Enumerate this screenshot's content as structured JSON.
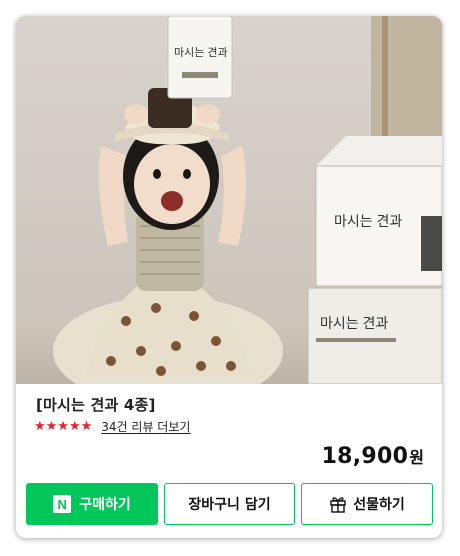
{
  "product": {
    "title": "[마시는 견과 4종]",
    "rating_stars": "★★★★★",
    "review_link": "34건 리뷰 더보기",
    "price": "18,900",
    "currency": "원",
    "package_text": "마시는 견과"
  },
  "buttons": {
    "buy_icon": "N",
    "buy_label": "구매하기",
    "cart_label": "장바구니 담기",
    "gift_label": "선물하기"
  },
  "colors": {
    "accent": "#03c75a",
    "star": "#e8232a"
  },
  "icons": [
    "naver-n-icon",
    "gift-icon"
  ]
}
